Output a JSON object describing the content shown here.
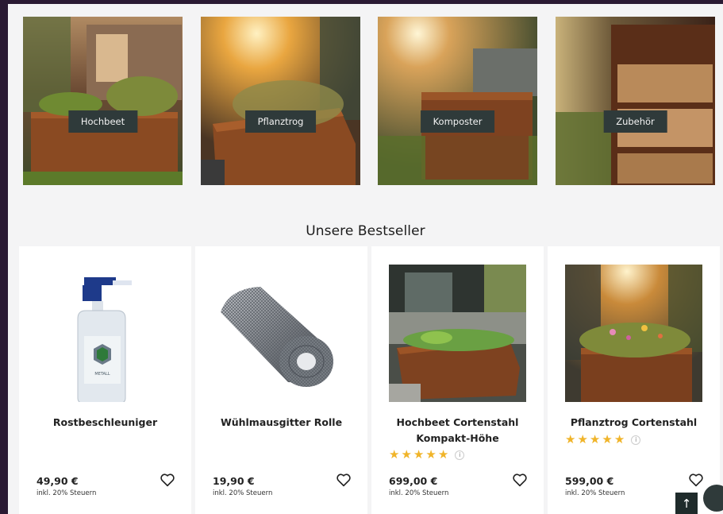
{
  "categories": [
    {
      "label": "Hochbeet"
    },
    {
      "label": "Pflanztrog"
    },
    {
      "label": "Komposter"
    },
    {
      "label": "Zubehör"
    }
  ],
  "bestseller": {
    "title": "Unsere Bestseller",
    "products": [
      {
        "name": "Rostbeschleuniger",
        "price": "49,90 €",
        "tax": "inkl. 20% Steuern",
        "rating": null
      },
      {
        "name": "Wühlmausgitter Rolle",
        "price": "19,90 €",
        "tax": "inkl. 20% Steuern",
        "rating": null
      },
      {
        "name": "Hochbeet Cortenstahl Kompakt-Höhe",
        "price": "699,00 €",
        "tax": "inkl. 20% Steuern",
        "rating": 5
      },
      {
        "name": "Pflanztrog Cortenstahl",
        "price": "599,00 €",
        "tax": "inkl. 20% Steuern",
        "rating": 5
      }
    ]
  },
  "bottle_brand": "METALL",
  "colors": {
    "label_bg": "#2f3a3a",
    "star": "#f0b429",
    "corten": "#8a4a22"
  },
  "icons": {
    "heart": "heart-icon",
    "scroll_top": "arrow-up-icon",
    "chat": "chat-icon",
    "info": "info-icon"
  }
}
